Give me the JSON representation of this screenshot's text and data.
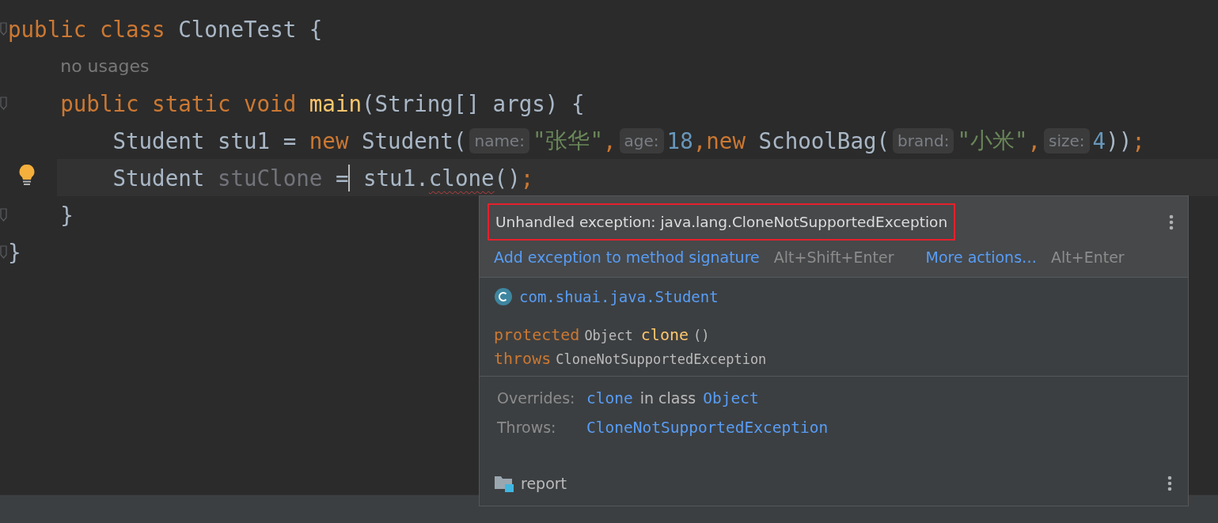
{
  "editor": {
    "lines": [
      {
        "fold": true,
        "current": false,
        "lightbulb": false,
        "tokens": [
          {
            "kind": "kw",
            "text": "public"
          },
          {
            "kind": "kw",
            "text": "class",
            "gap": true
          },
          {
            "kind": "plain",
            "text": "CloneTest",
            "gap": true
          },
          {
            "kind": "plain",
            "text": "{",
            "gap": true
          }
        ],
        "children": [
          {
            "fold": false,
            "current": false,
            "lightbulb": false,
            "tokens": [
              {
                "kind": "lens",
                "text": "no usages"
              }
            ]
          },
          {
            "fold": true,
            "current": false,
            "lightbulb": false,
            "tokens": [
              {
                "kind": "kw",
                "text": "public"
              },
              {
                "kind": "kw",
                "text": "static",
                "gap": true
              },
              {
                "kind": "kw",
                "text": "void",
                "gap": true
              },
              {
                "kind": "fn",
                "text": "main",
                "gap": true
              },
              {
                "kind": "plain",
                "text": "(String[]"
              },
              {
                "kind": "plain",
                "text": "args)",
                "gap": true
              },
              {
                "kind": "plain",
                "text": "{",
                "gap": true
              }
            ],
            "children": [
              {
                "fold": false,
                "current": false,
                "lightbulb": false,
                "tokens": [
                  {
                    "kind": "plain",
                    "text": "Student"
                  },
                  {
                    "kind": "plain",
                    "text": "stu1",
                    "gap": true
                  },
                  {
                    "kind": "plain",
                    "text": "=",
                    "gap": true
                  },
                  {
                    "kind": "kw",
                    "text": "new",
                    "gap": true
                  },
                  {
                    "kind": "plain",
                    "text": "Student(",
                    "gap": true
                  },
                  {
                    "kind": "hint",
                    "text": "name:"
                  },
                  {
                    "kind": "str",
                    "text": "\"张华\""
                  },
                  {
                    "kind": "kw",
                    "text": ","
                  },
                  {
                    "kind": "hint",
                    "text": "age:"
                  },
                  {
                    "kind": "num",
                    "text": "18"
                  },
                  {
                    "kind": "kw",
                    "text": ","
                  },
                  {
                    "kind": "kw",
                    "text": "new"
                  },
                  {
                    "kind": "plain",
                    "text": "SchoolBag(",
                    "gap": true
                  },
                  {
                    "kind": "hint",
                    "text": "brand:"
                  },
                  {
                    "kind": "str",
                    "text": "\"小米\""
                  },
                  {
                    "kind": "kw",
                    "text": ","
                  },
                  {
                    "kind": "hint",
                    "text": "size:"
                  },
                  {
                    "kind": "num",
                    "text": "4"
                  },
                  {
                    "kind": "plain",
                    "text": "))"
                  },
                  {
                    "kind": "kw",
                    "text": ";"
                  }
                ]
              },
              {
                "fold": false,
                "current": true,
                "lightbulb": true,
                "tokens": [
                  {
                    "kind": "plain",
                    "text": "Student"
                  },
                  {
                    "kind": "unused",
                    "text": "stuClone",
                    "gap": true
                  },
                  {
                    "kind": "plain",
                    "text": "=",
                    "gap": true,
                    "caret": true
                  },
                  {
                    "kind": "plain",
                    "text": "stu1.",
                    "gap": true
                  },
                  {
                    "kind": "error",
                    "text": "clone"
                  },
                  {
                    "kind": "plain",
                    "text": "()"
                  },
                  {
                    "kind": "kw",
                    "text": ";"
                  }
                ]
              }
            ]
          },
          {
            "fold": true,
            "current": false,
            "lightbulb": false,
            "tokens": [
              {
                "kind": "plain",
                "text": "}"
              }
            ]
          }
        ]
      },
      {
        "fold": true,
        "current": false,
        "lightbulb": false,
        "tokens": [
          {
            "kind": "plain",
            "text": "}"
          }
        ]
      }
    ]
  },
  "popup": {
    "message": "Unhandled exception: java.lang.CloneNotSupportedException",
    "message_highlighted": true,
    "actions": [
      {
        "label": "Add exception to method signature",
        "shortcut": "Alt+Shift+Enter"
      },
      {
        "label": "More actions…",
        "shortcut": "Alt+Enter"
      }
    ],
    "class_name": "com.shuai.java.Student",
    "signature": [
      [
        {
          "kind": "kw",
          "text": "protected"
        },
        {
          "kind": "type",
          "text": "Object"
        },
        {
          "kind": "fn",
          "text": "clone"
        },
        {
          "kind": "type",
          "text": "()"
        }
      ],
      [
        {
          "kind": "kw",
          "text": "throws"
        },
        {
          "kind": "type",
          "text": "CloneNotSupportedException"
        }
      ]
    ],
    "sections": [
      {
        "label": "Overrides:",
        "parts": [
          {
            "kind": "link",
            "text": "clone"
          },
          {
            "kind": "plain",
            "text": "in class"
          },
          {
            "kind": "link",
            "text": "Object"
          }
        ]
      },
      {
        "label": "Throws:",
        "parts": [
          {
            "kind": "link",
            "text": "CloneNotSupportedException"
          }
        ]
      }
    ],
    "module": "report"
  }
}
